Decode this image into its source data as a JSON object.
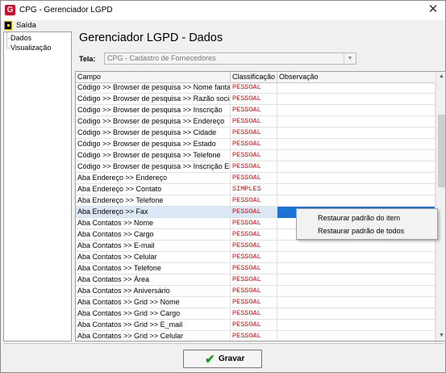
{
  "window": {
    "title": "CPG - Gerenciador LGPD",
    "app_icon_letter": "G",
    "close_glyph": "✕"
  },
  "menu": {
    "saida_label": "Saída"
  },
  "tree": {
    "items": [
      "Dados",
      "Visualização"
    ]
  },
  "heading": "Gerenciador LGPD - Dados",
  "tela": {
    "label": "Tela:",
    "value": "CPG - Cadastro de Fornecedores"
  },
  "grid": {
    "columns": [
      "Campo",
      "Classificação",
      "Observação"
    ],
    "rows": [
      [
        "Código >> Browser de pesquisa >> Nome fantasia",
        "PESSOAL",
        ""
      ],
      [
        "Código >> Browser de pesquisa >> Razão social",
        "PESSOAL",
        ""
      ],
      [
        "Código >> Browser de pesquisa >> Inscrição",
        "PESSOAL",
        ""
      ],
      [
        "Código >> Browser de pesquisa >> Endereço",
        "PESSOAL",
        ""
      ],
      [
        "Código >> Browser de pesquisa >> Cidade",
        "PESSOAL",
        ""
      ],
      [
        "Código >> Browser de pesquisa >> Estado",
        "PESSOAL",
        ""
      ],
      [
        "Código >> Browser de pesquisa >> Telefone",
        "PESSOAL",
        ""
      ],
      [
        "Código >> Browser de pesquisa >> Inscrição Esta...",
        "PESSOAL",
        ""
      ],
      [
        "Aba Endereço >> Endereço",
        "PESSOAL",
        ""
      ],
      [
        "Aba Endereço >> Contato",
        "SIMPLES",
        ""
      ],
      [
        "Aba Endereço >> Telefone",
        "PESSOAL",
        ""
      ],
      [
        "Aba Endereço >> Fax",
        "PESSOAL",
        ""
      ],
      [
        "Aba Contatos >> Nome",
        "PESSOAL",
        ""
      ],
      [
        "Aba Contatos >> Cargo",
        "PESSOAL",
        ""
      ],
      [
        "Aba Contatos >> E-mail",
        "PESSOAL",
        ""
      ],
      [
        "Aba Contatos >> Celular",
        "PESSOAL",
        ""
      ],
      [
        "Aba Contatos >> Telefone",
        "PESSOAL",
        ""
      ],
      [
        "Aba Contatos >> Área",
        "PESSOAL",
        ""
      ],
      [
        "Aba Contatos >> Aniversário",
        "PESSOAL",
        ""
      ],
      [
        "Aba Contatos >> Grid >> Nome",
        "PESSOAL",
        ""
      ],
      [
        "Aba Contatos >> Grid >> Cargo",
        "PESSOAL",
        ""
      ],
      [
        "Aba Contatos >> Grid >> E_mail",
        "PESSOAL",
        ""
      ],
      [
        "Aba Contatos >> Grid >> Celular",
        "PESSOAL",
        ""
      ]
    ],
    "selected_row_index": 11
  },
  "context_menu": {
    "items": [
      "Restaurar padrão do item",
      "Restaurar padrão de todos"
    ]
  },
  "footer": {
    "gravar_label": "Gravar"
  },
  "colors": {
    "classification_text": "#e00000",
    "selection": "#1f72d6",
    "row_highlight": "#dce8f5",
    "gravar_check": "#1a9a1a"
  },
  "icons": {
    "app": "cpg-logo-icon",
    "menu": "exit-door-icon",
    "gravar": "checkmark-icon"
  }
}
